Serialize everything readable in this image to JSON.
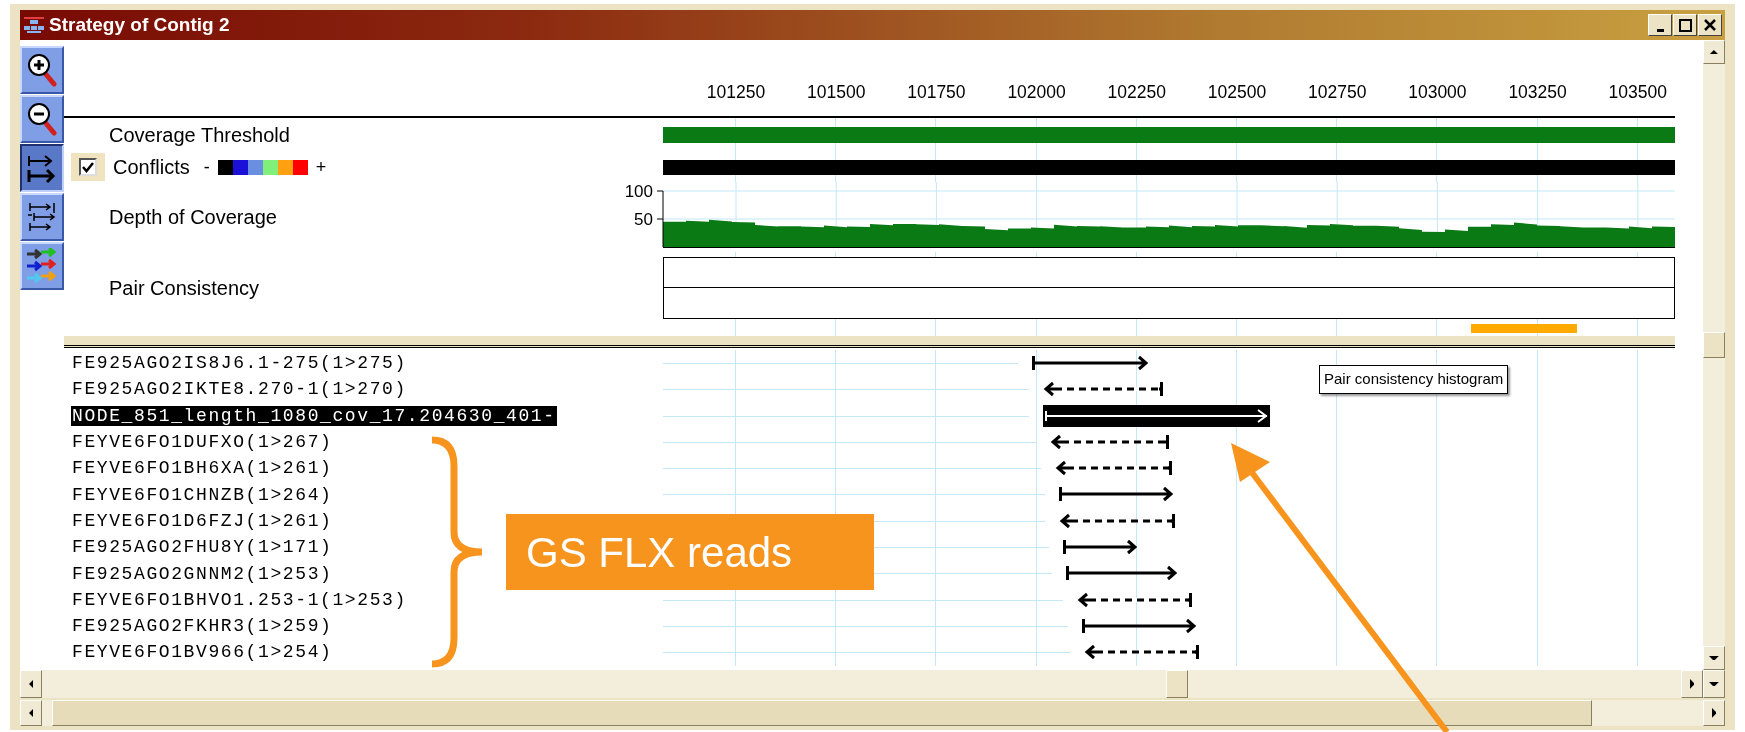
{
  "window": {
    "title": "Strategy of Contig 2"
  },
  "toolbar": [
    {
      "kind": "zoom-in",
      "selected": false
    },
    {
      "kind": "zoom-out",
      "selected": false
    },
    {
      "kind": "pack",
      "selected": true
    },
    {
      "kind": "stack",
      "selected": false
    },
    {
      "kind": "color",
      "selected": false
    }
  ],
  "ruler": {
    "labels": [
      "101250",
      "101500",
      "101750",
      "102000",
      "102250",
      "102500",
      "102750",
      "103000",
      "103250",
      "103500"
    ]
  },
  "tracks": [
    {
      "kind": "threshold",
      "label": "Coverage Threshold"
    },
    {
      "kind": "conflicts",
      "label": "Conflicts",
      "checked": true,
      "legend_low": "-",
      "legend_high": "+",
      "legend": [
        {
          "color": "#000000"
        },
        {
          "color": "#1a10d8"
        },
        {
          "color": "#6a8fe0"
        },
        {
          "color": "#80f07a"
        },
        {
          "color": "#ffa010"
        },
        {
          "color": "#ff0000"
        }
      ]
    },
    {
      "kind": "depth",
      "label": "Depth of Coverage",
      "axis_labels": [
        "100",
        "50"
      ]
    },
    {
      "kind": "pair",
      "label": "Pair Consistency"
    }
  ],
  "reads": [
    {
      "name": "FE925AGO2IS8J6.1-275(1>275)",
      "kind": "forward",
      "selected": false
    },
    {
      "name": "FE925AGO2IKTE8.270-1(1>270)",
      "kind": "reverse",
      "selected": false
    },
    {
      "name": "NODE_851_length_1080_cov_17.204630_401-",
      "kind": "forward",
      "selected": true
    },
    {
      "name": "FEYVE6FO1DUFXO(1>267)",
      "kind": "reverse",
      "selected": false
    },
    {
      "name": "FEYVE6FO1BH6XA(1>261)",
      "kind": "reverse",
      "selected": false
    },
    {
      "name": "FEYVE6FO1CHNZB(1>264)",
      "kind": "forward",
      "selected": false
    },
    {
      "name": "FEYVE6FO1D6FZJ(1>261)",
      "kind": "reverse",
      "selected": false
    },
    {
      "name": "FE925AGO2FHU8Y(1>171)",
      "kind": "forward",
      "selected": false
    },
    {
      "name": "FE925AGO2GNNM2(1>253)",
      "kind": "forward",
      "selected": false
    },
    {
      "name": "FEYVE6FO1BHVO1.253-1(1>253)",
      "kind": "reverse",
      "selected": false
    },
    {
      "name": "FE925AGO2FKHR3(1>259)",
      "kind": "forward",
      "selected": false
    },
    {
      "name": "FEYVE6FO1BV966(1>254)",
      "kind": "reverse",
      "selected": false
    }
  ],
  "tooltip": {
    "text": "Pair consistency histogram"
  },
  "annotation": {
    "text": "GS FLX reads"
  }
}
